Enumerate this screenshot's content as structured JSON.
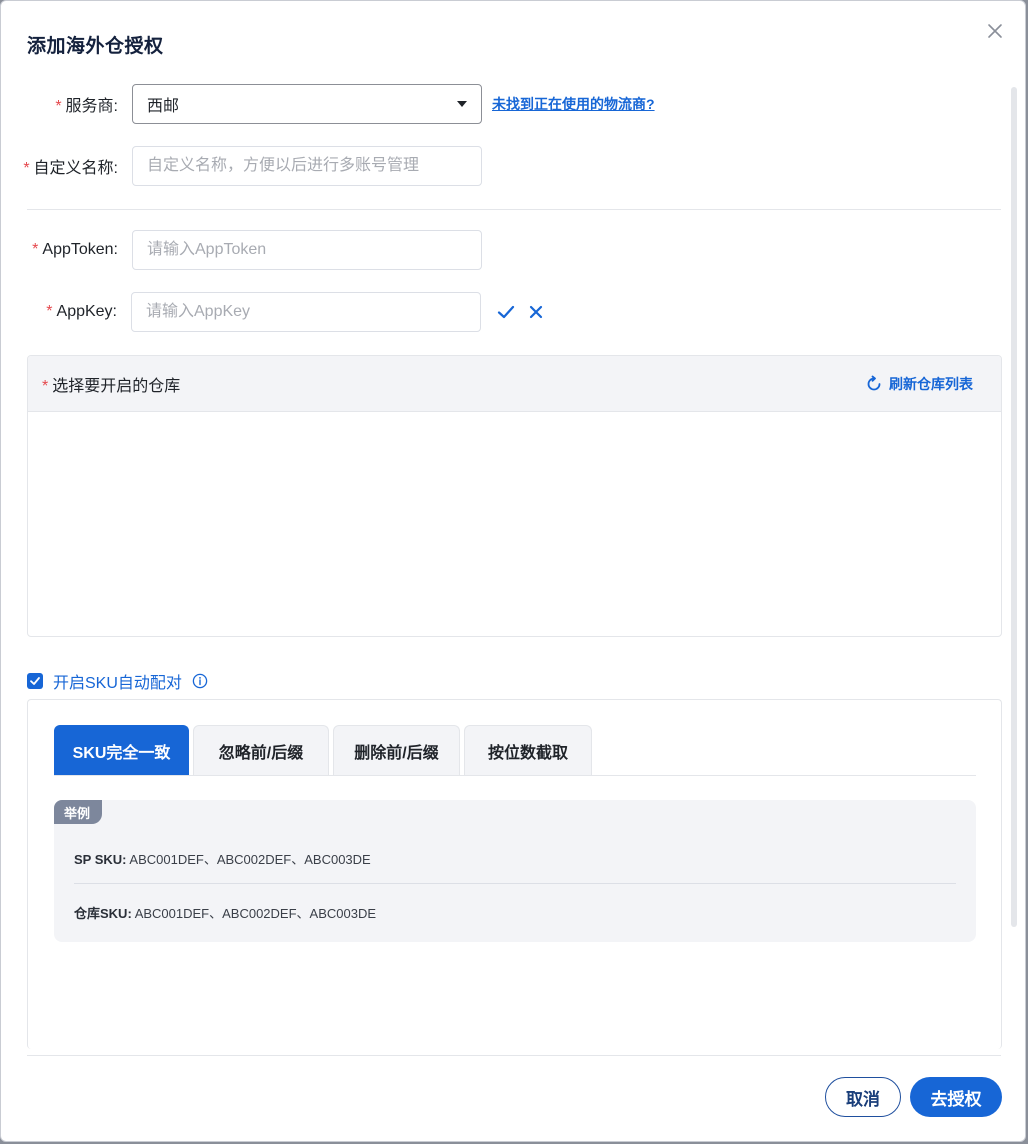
{
  "dialog": {
    "title": "添加海外仓授权",
    "close_icon": "close-icon"
  },
  "form": {
    "provider": {
      "label": "服务商:",
      "value": "西邮",
      "link": "未找到正在使用的物流商?"
    },
    "custom_name": {
      "label": "自定义名称:",
      "placeholder": "自定义名称，方便以后进行多账号管理"
    },
    "app_token": {
      "label": "AppToken:",
      "placeholder": "请输入AppToken"
    },
    "app_key": {
      "label": "AppKey:",
      "placeholder": "请输入AppKey",
      "confirm_icon": "check-icon",
      "clear_icon": "close-icon"
    },
    "required_mark": "*"
  },
  "warehouse": {
    "title": "选择要开启的仓库",
    "refresh_label": "刷新仓库列表",
    "refresh_icon": "refresh-icon"
  },
  "sku_match": {
    "checkbox_label": "开启SKU自动配对",
    "checked": true,
    "info_icon": "info-icon",
    "tabs": [
      {
        "label": "SKU完全一致",
        "active": true
      },
      {
        "label": "忽略前/后缀",
        "active": false
      },
      {
        "label": "删除前/后缀",
        "active": false
      },
      {
        "label": "按位数截取",
        "active": false
      }
    ],
    "example": {
      "badge": "举例",
      "sp_sku_label": "SP SKU:",
      "sp_sku_value": "ABC001DEF、ABC002DEF、ABC003DE",
      "wh_sku_label": "仓库SKU:",
      "wh_sku_value": "ABC001DEF、ABC002DEF、ABC003DE"
    }
  },
  "footer": {
    "cancel_label": "取消",
    "submit_label": "去授权"
  },
  "colors": {
    "primary": "#1766d6",
    "required": "#e5484d",
    "title": "#14213d"
  }
}
